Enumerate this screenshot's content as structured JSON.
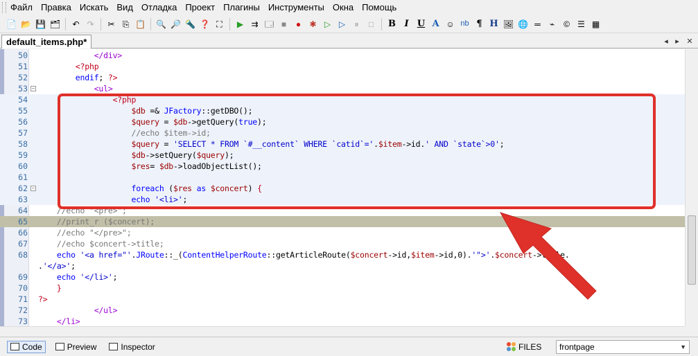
{
  "menu": [
    "Файл",
    "Правка",
    "Искать",
    "Вид",
    "Отладка",
    "Проект",
    "Плагины",
    "Инструменты",
    "Окна",
    "Помощь"
  ],
  "toolbar": {
    "format_bold": "B",
    "format_italic": "I",
    "format_underline": "U",
    "format_font": "A",
    "format_nbsp": "nb",
    "format_paragraph": "¶",
    "format_heading": "H"
  },
  "tab": {
    "title": "default_items.php*"
  },
  "code_lines": [
    {
      "n": "50",
      "segs": [
        [
          "c-txt",
          "            "
        ],
        [
          "c-tag",
          "</div>"
        ]
      ]
    },
    {
      "n": "51",
      "segs": [
        [
          "c-txt",
          "        "
        ],
        [
          "c-php",
          "<?php"
        ]
      ]
    },
    {
      "n": "52",
      "segs": [
        [
          "c-txt",
          "        "
        ],
        [
          "c-kw",
          "endif"
        ],
        [
          "c-txt",
          "; "
        ],
        [
          "c-php",
          "?>"
        ]
      ]
    },
    {
      "n": "53",
      "segs": [
        [
          "c-txt",
          "            "
        ],
        [
          "c-tag",
          "<ul>"
        ]
      ]
    },
    {
      "n": "54",
      "segs": [
        [
          "c-txt",
          "                "
        ],
        [
          "c-php",
          "<?php"
        ]
      ]
    },
    {
      "n": "55",
      "segs": [
        [
          "c-txt",
          "                    "
        ],
        [
          "c-var",
          "$db"
        ],
        [
          "c-txt",
          " =& "
        ],
        [
          "c-cls",
          "JFactory"
        ],
        [
          "c-txt",
          "::getDBO();"
        ]
      ]
    },
    {
      "n": "56",
      "segs": [
        [
          "c-txt",
          "                    "
        ],
        [
          "c-var",
          "$query"
        ],
        [
          "c-txt",
          " = "
        ],
        [
          "c-var",
          "$db"
        ],
        [
          "c-txt",
          "->getQuery("
        ],
        [
          "c-kw",
          "true"
        ],
        [
          "c-txt",
          ");"
        ]
      ]
    },
    {
      "n": "57",
      "segs": [
        [
          "c-txt",
          "                    "
        ],
        [
          "c-cmt",
          "//echo $item->id;"
        ]
      ]
    },
    {
      "n": "58",
      "segs": [
        [
          "c-txt",
          "                    "
        ],
        [
          "c-var",
          "$query"
        ],
        [
          "c-txt",
          " = "
        ],
        [
          "c-str",
          "'SELECT * FROM `#__content` WHERE `catid`='"
        ],
        [
          "c-txt",
          "."
        ],
        [
          "c-var",
          "$item"
        ],
        [
          "c-txt",
          "->id."
        ],
        [
          "c-str",
          "' AND `state`>0'"
        ],
        [
          "c-txt",
          ";"
        ]
      ]
    },
    {
      "n": "59",
      "segs": [
        [
          "c-txt",
          "                    "
        ],
        [
          "c-var",
          "$db"
        ],
        [
          "c-txt",
          "->setQuery("
        ],
        [
          "c-var",
          "$query"
        ],
        [
          "c-txt",
          ");"
        ]
      ]
    },
    {
      "n": "60",
      "segs": [
        [
          "c-txt",
          "                    "
        ],
        [
          "c-var",
          "$res"
        ],
        [
          "c-txt",
          "= "
        ],
        [
          "c-var",
          "$db"
        ],
        [
          "c-txt",
          "->loadObjectList();"
        ]
      ]
    },
    {
      "n": "61",
      "segs": [
        [
          "c-txt",
          ""
        ]
      ]
    },
    {
      "n": "62",
      "segs": [
        [
          "c-txt",
          "                    "
        ],
        [
          "c-kw",
          "foreach"
        ],
        [
          "c-txt",
          " ("
        ],
        [
          "c-var",
          "$res"
        ],
        [
          "c-txt",
          " "
        ],
        [
          "c-kw",
          "as"
        ],
        [
          "c-txt",
          " "
        ],
        [
          "c-var",
          "$concert"
        ],
        [
          "c-txt",
          ") "
        ],
        [
          "c-php",
          "{"
        ]
      ]
    },
    {
      "n": "63",
      "segs": [
        [
          "c-txt",
          "                    "
        ],
        [
          "c-kw",
          "echo"
        ],
        [
          "c-txt",
          " "
        ],
        [
          "c-str",
          "'<li>'"
        ],
        [
          "c-txt",
          ";"
        ]
      ]
    },
    {
      "n": "64",
      "segs": [
        [
          "c-txt",
          "    "
        ],
        [
          "c-cmt",
          "//echo \"<pre>\";"
        ]
      ]
    },
    {
      "n": "65",
      "segs": [
        [
          "c-txt",
          "    "
        ],
        [
          "c-cmt",
          "//print_r ($concert);"
        ]
      ]
    },
    {
      "n": "66",
      "segs": [
        [
          "c-txt",
          "    "
        ],
        [
          "c-cmt",
          "//echo \"</pre>\";"
        ]
      ]
    },
    {
      "n": "67",
      "segs": [
        [
          "c-txt",
          "    "
        ],
        [
          "c-cmt",
          "//echo $concert->title;"
        ]
      ]
    },
    {
      "n": "68",
      "segs": [
        [
          "c-txt",
          "    "
        ],
        [
          "c-kw",
          "echo"
        ],
        [
          "c-txt",
          " "
        ],
        [
          "c-str",
          "'<a href=\"'"
        ],
        [
          "c-txt",
          "."
        ],
        [
          "c-cls",
          "JRoute"
        ],
        [
          "c-txt",
          "::_("
        ],
        [
          "c-cls",
          "ContentHelperRoute"
        ],
        [
          "c-txt",
          "::getArticleRoute("
        ],
        [
          "c-var",
          "$concert"
        ],
        [
          "c-txt",
          "->id,"
        ],
        [
          "c-var",
          "$item"
        ],
        [
          "c-txt",
          "->id,0)."
        ],
        [
          "c-str",
          "'\">'"
        ],
        [
          "c-txt",
          "."
        ],
        [
          "c-var",
          "$concert"
        ],
        [
          "c-txt",
          "->title."
        ]
      ]
    },
    {
      "n": "",
      "segs": [
        [
          "c-txt",
          "."
        ],
        [
          "c-str",
          "'</a>'"
        ],
        [
          "c-txt",
          ";"
        ]
      ]
    },
    {
      "n": "69",
      "segs": [
        [
          "c-txt",
          "    "
        ],
        [
          "c-kw",
          "echo"
        ],
        [
          "c-txt",
          " "
        ],
        [
          "c-str",
          "'</li>'"
        ],
        [
          "c-txt",
          ";"
        ]
      ]
    },
    {
      "n": "70",
      "segs": [
        [
          "c-txt",
          "    "
        ],
        [
          "c-php",
          "}"
        ]
      ]
    },
    {
      "n": "71",
      "segs": [
        [
          "c-php",
          "?>"
        ]
      ]
    },
    {
      "n": "72",
      "segs": [
        [
          "c-txt",
          "            "
        ],
        [
          "c-tag",
          "</ul>"
        ]
      ]
    },
    {
      "n": "73",
      "segs": [
        [
          "c-txt",
          "    "
        ],
        [
          "c-tag",
          "</li>"
        ]
      ]
    }
  ],
  "status": {
    "code_label": "Code",
    "preview_label": "Preview",
    "inspector_label": "Inspector",
    "files_label": "FILES",
    "profile_value": "frontpage"
  },
  "colors": {
    "annotation": "#e0302a",
    "current_line": "#c1bfa7",
    "line_numbers": "#3a6ea5"
  }
}
